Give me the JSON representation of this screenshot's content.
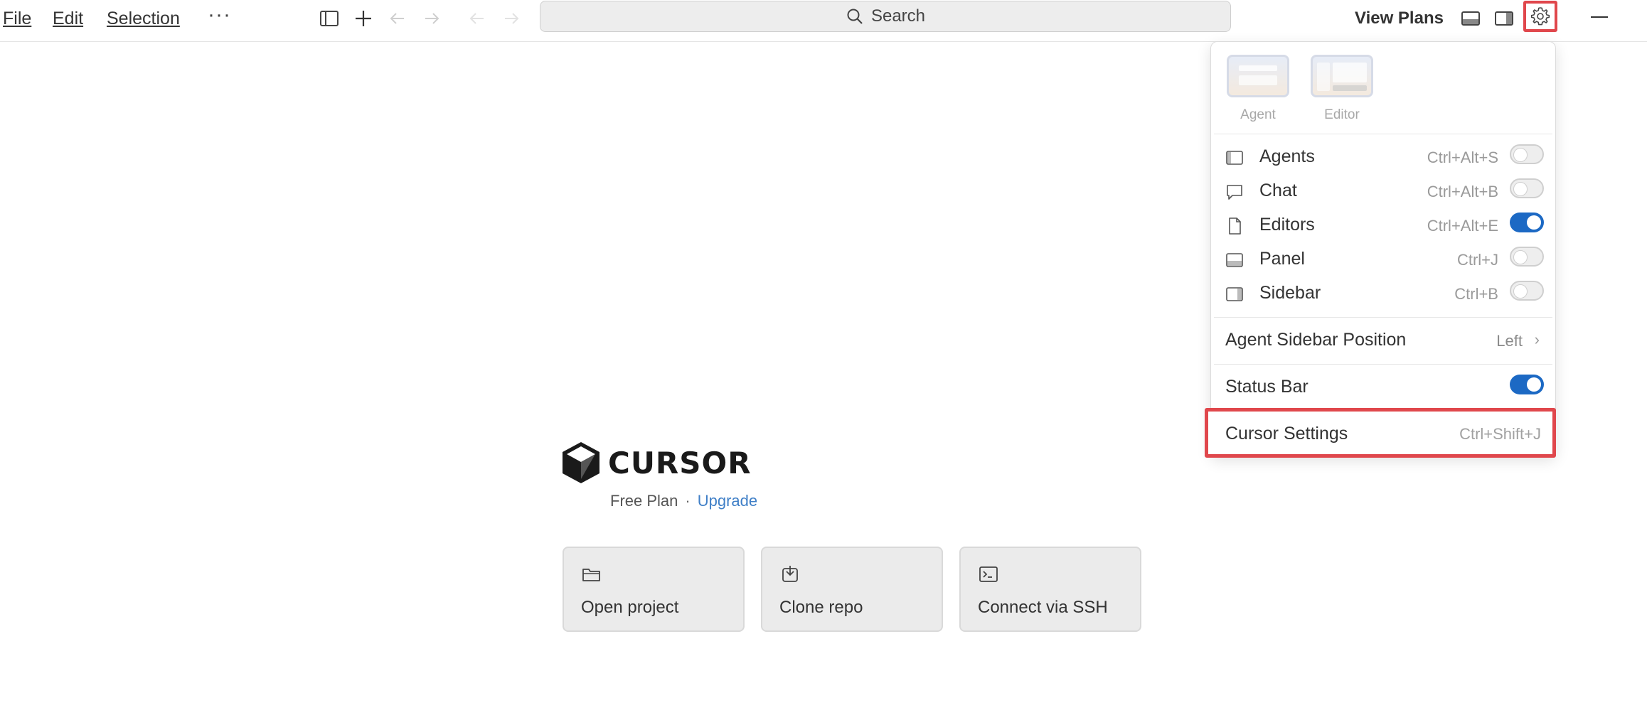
{
  "menu": {
    "file": "File",
    "edit": "Edit",
    "selection": "Selection",
    "more": "···"
  },
  "titlebar": {
    "search_label": "Search",
    "view_plans": "View Plans",
    "icons": [
      "sidebar-toggle-icon",
      "plus-icon",
      "back-arrow-icon",
      "forward-arrow-icon",
      "search-icon",
      "panel-layout-icon",
      "sidebar-right-icon",
      "gear-icon",
      "minimize-icon"
    ]
  },
  "welcome": {
    "logo_text": "CURSOR",
    "plan": "Free Plan",
    "separator": "·",
    "upgrade": "Upgrade",
    "actions": [
      {
        "label": "Open project",
        "icon": "folder-icon"
      },
      {
        "label": "Clone repo",
        "icon": "clone-icon"
      },
      {
        "label": "Connect via SSH",
        "icon": "terminal-icon"
      }
    ]
  },
  "dropdown": {
    "layouts": [
      {
        "label": "Agent"
      },
      {
        "label": "Editor"
      }
    ],
    "toggles": [
      {
        "label": "Agents",
        "shortcut": "Ctrl+Alt+S",
        "on": false,
        "icon": "sidebar-left-icon"
      },
      {
        "label": "Chat",
        "shortcut": "Ctrl+Alt+B",
        "on": false,
        "icon": "chat-icon"
      },
      {
        "label": "Editors",
        "shortcut": "Ctrl+Alt+E",
        "on": true,
        "icon": "file-icon"
      },
      {
        "label": "Panel",
        "shortcut": "Ctrl+J",
        "on": false,
        "icon": "panel-icon"
      },
      {
        "label": "Sidebar",
        "shortcut": "Ctrl+B",
        "on": false,
        "icon": "sidebar-right-icon"
      }
    ],
    "agent_sidebar_position": {
      "label": "Agent Sidebar Position",
      "value": "Left"
    },
    "status_bar": {
      "label": "Status Bar",
      "on": true
    },
    "cursor_settings": {
      "label": "Cursor Settings",
      "shortcut": "Ctrl+Shift+J"
    }
  },
  "colors": {
    "accent_blue": "#1c69c4",
    "highlight_red": "#e0474c",
    "link_blue": "#3f7fc7"
  }
}
